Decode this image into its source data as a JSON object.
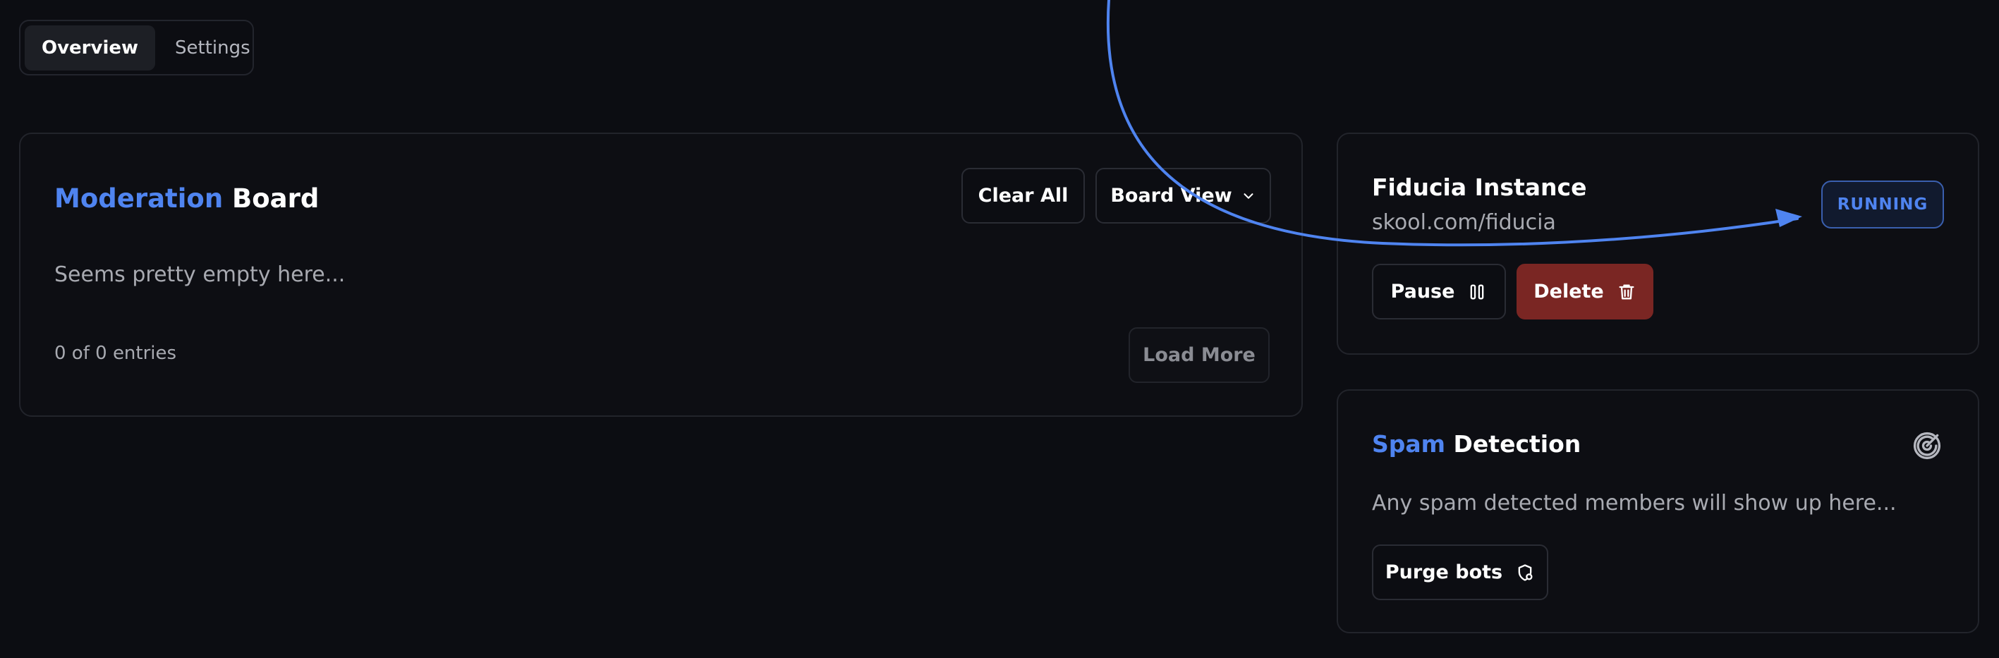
{
  "tabs": [
    {
      "label": "Overview",
      "active": true
    },
    {
      "label": "Settings",
      "active": false
    }
  ],
  "moderation": {
    "title_accent": "Moderation",
    "title_rest": " Board",
    "clear_all_label": "Clear All",
    "board_view_label": "Board View",
    "empty_text": "Seems pretty empty here...",
    "entries_text": "0 of 0 entries",
    "load_more_label": "Load More"
  },
  "instance": {
    "title": "Fiducia Instance",
    "url": "skool.com/fiducia",
    "status": "RUNNING",
    "pause_label": "Pause",
    "delete_label": "Delete"
  },
  "spam": {
    "title_accent": "Spam",
    "title_rest": " Detection",
    "description": "Any spam detected members will show up here...",
    "purge_label": "Purge bots"
  },
  "colors": {
    "background": "#0c0d12",
    "accent": "#4f84f0",
    "danger": "#7a2623"
  }
}
